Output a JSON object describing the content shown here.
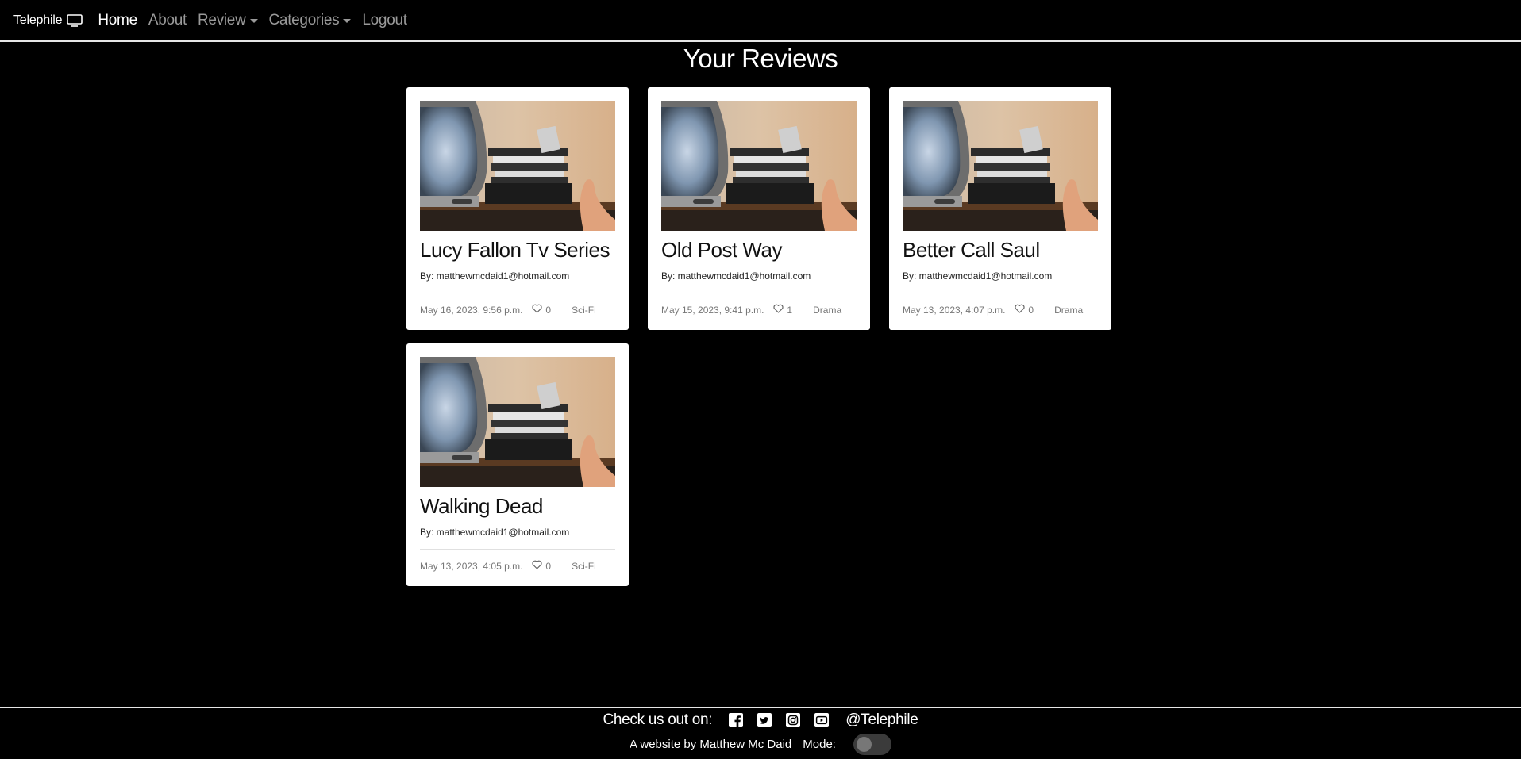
{
  "nav": {
    "brand": "Telephile",
    "brand_icon": "tv-icon",
    "links": [
      {
        "label": "Home",
        "active": true
      },
      {
        "label": "About"
      },
      {
        "label": "Review",
        "dropdown": true
      },
      {
        "label": "Categories",
        "dropdown": true
      },
      {
        "label": "Logout"
      }
    ]
  },
  "page": {
    "title": "Your Reviews"
  },
  "reviews": [
    {
      "title": "Lucy Fallon Tv Series",
      "author": "By: matthewmcdaid1@hotmail.com",
      "date": "May 16, 2023, 9:56 p.m.",
      "likes": "0",
      "category": "Sci-Fi"
    },
    {
      "title": "Old Post Way",
      "author": "By: matthewmcdaid1@hotmail.com",
      "date": "May 15, 2023, 9:41 p.m.",
      "likes": "1",
      "category": "Drama"
    },
    {
      "title": "Better Call Saul",
      "author": "By: matthewmcdaid1@hotmail.com",
      "date": "May 13, 2023, 4:07 p.m.",
      "likes": "0",
      "category": "Drama"
    },
    {
      "title": "Walking Dead",
      "author": "By: matthewmcdaid1@hotmail.com",
      "date": "May 13, 2023, 4:05 p.m.",
      "likes": "0",
      "category": "Sci-Fi"
    }
  ],
  "footer": {
    "check_text": "Check us out on:",
    "social_icons": [
      "facebook-icon",
      "twitter-icon",
      "instagram-icon",
      "youtube-icon"
    ],
    "handle": "@Telephile",
    "credit": "A website by Matthew Mc Daid",
    "mode_label": "Mode:"
  }
}
